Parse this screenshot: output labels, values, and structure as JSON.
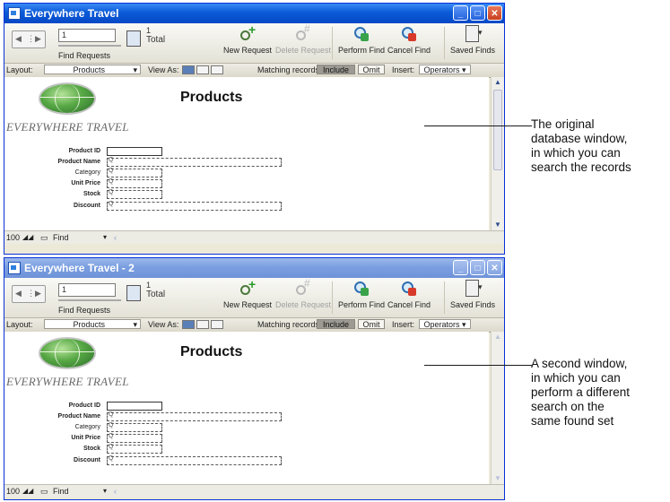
{
  "windows": [
    {
      "title": "Everywhere Travel",
      "toolbar": {
        "record_value": "1",
        "find_requests_label": "Find Requests",
        "total_count": "1",
        "total_label": "Total",
        "new_request": "New Request",
        "delete_request": "Delete Request",
        "perform_find": "Perform Find",
        "cancel_find": "Cancel Find",
        "saved_finds": "Saved Finds"
      },
      "layoutbar": {
        "layout_label": "Layout:",
        "layout_value": "Products",
        "view_as_label": "View As:",
        "matching_label": "Matching records:",
        "include": "Include",
        "omit": "Omit",
        "insert_label": "Insert:",
        "operators": "Operators"
      },
      "content": {
        "brand": "EVERYWHERE TRAVEL",
        "title": "Products",
        "fields": [
          {
            "label": "Product ID"
          },
          {
            "label": "Product Name"
          },
          {
            "label": "Category"
          },
          {
            "label": "Unit Price"
          },
          {
            "label": "Stock"
          },
          {
            "label": "Discount"
          }
        ]
      },
      "statusbar": {
        "zoom": "100",
        "mode": "Find"
      }
    },
    {
      "title": "Everywhere Travel - 2",
      "toolbar": {
        "record_value": "1",
        "find_requests_label": "Find Requests",
        "total_count": "1",
        "total_label": "Total",
        "new_request": "New Request",
        "delete_request": "Delete Request",
        "perform_find": "Perform Find",
        "cancel_find": "Cancel Find",
        "saved_finds": "Saved Finds"
      },
      "layoutbar": {
        "layout_label": "Layout:",
        "layout_value": "Products",
        "view_as_label": "View As:",
        "matching_label": "Matching records:",
        "include": "Include",
        "omit": "Omit",
        "insert_label": "Insert:",
        "operators": "Operators"
      },
      "content": {
        "brand": "EVERYWHERE TRAVEL",
        "title": "Products",
        "fields": [
          {
            "label": "Product ID"
          },
          {
            "label": "Product Name"
          },
          {
            "label": "Category"
          },
          {
            "label": "Unit Price"
          },
          {
            "label": "Stock"
          },
          {
            "label": "Discount"
          }
        ]
      },
      "statusbar": {
        "zoom": "100",
        "mode": "Find"
      }
    }
  ],
  "annotations": [
    {
      "lines": [
        "The original",
        "database window,",
        "in which you can",
        "search the records"
      ]
    },
    {
      "lines": [
        "A second window,",
        "in which you can",
        "perform a different",
        "search on the",
        "same found set"
      ]
    }
  ],
  "icons": {
    "app": "app-window-icon",
    "minimize": "minimize-icon",
    "maximize": "maximize-icon",
    "close": "close-icon",
    "new_request": "new-request-icon",
    "delete_request": "delete-request-icon",
    "perform_find": "perform-find-icon",
    "cancel_find": "cancel-find-icon",
    "saved_finds": "saved-finds-icon",
    "magnifier": "magnifier-icon"
  }
}
